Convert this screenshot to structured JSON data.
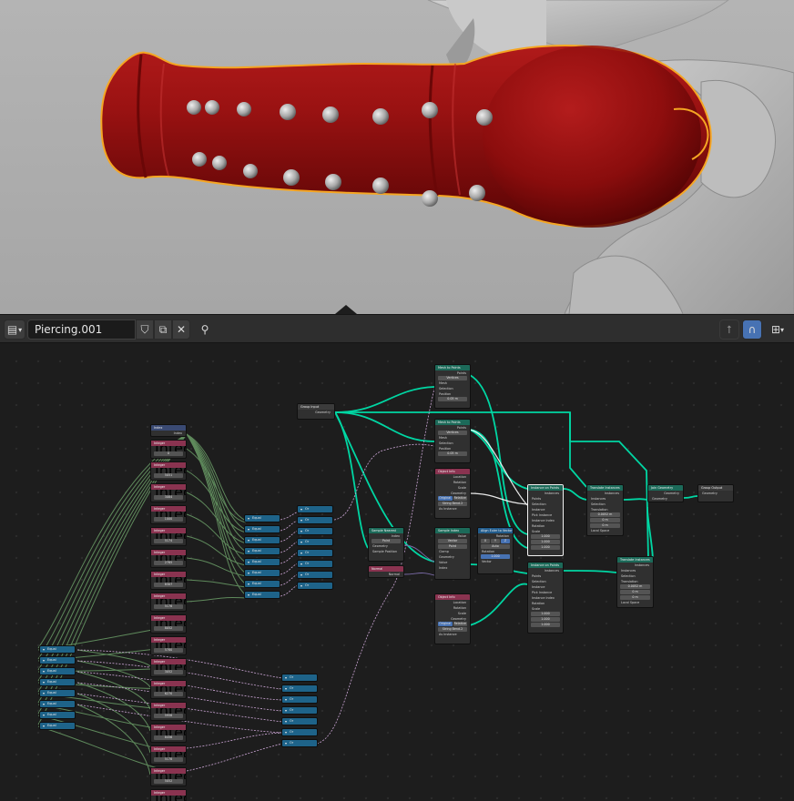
{
  "header": {
    "editor_type_icon": "geometry-node-editor-icon",
    "node_group_name": "Piercing.001"
  },
  "nodes": {
    "index": {
      "title": "Index",
      "out": "Index"
    },
    "integer_title": "Integer",
    "integer_out": "Integer",
    "integer_values": [
      "0",
      "5051",
      "3084",
      "1000",
      "5174",
      "2785",
      "8307",
      "5178",
      "8052",
      "5780",
      "3052",
      "6270",
      "5958",
      "8456",
      "5178",
      "5052",
      "10856",
      "10768"
    ],
    "equal_label": "Equal",
    "or_label": "Or",
    "group_input": {
      "title": "Group Input",
      "out": "Geometry"
    },
    "group_output": {
      "title": "Group Output",
      "in": "Geometry"
    },
    "mesh_to_points_a": {
      "title": "Mesh to Points",
      "out": "Points",
      "mode": "Vertices",
      "rows": [
        "Mesh",
        "Selection",
        "Position",
        "Radius"
      ],
      "radius": "0.05 m"
    },
    "mesh_to_points_b": {
      "title": "Mesh to Points",
      "out": "Points",
      "mode": "Vertices",
      "rows": [
        "Mesh",
        "Selection",
        "Position",
        "Radius"
      ],
      "radius": "0.05 m"
    },
    "object_info_a": {
      "title": "Object Info",
      "rows": [
        "Location",
        "Rotation",
        "Scale",
        "Geometry"
      ],
      "toggle_a": "Original",
      "toggle_b": "Relative",
      "object": "String Bend.2",
      "as_instance": "As Instance"
    },
    "object_info_b": {
      "title": "Object Info",
      "rows": [
        "Location",
        "Rotation",
        "Scale",
        "Geometry"
      ],
      "toggle_a": "Original",
      "toggle_b": "Relative",
      "object": "String Bend.2",
      "as_instance": "As Instance"
    },
    "sample_nearest": {
      "title": "Sample Nearest",
      "out": "Index",
      "mode": "Point",
      "rows": [
        "Geometry",
        "Sample Position"
      ]
    },
    "normal": {
      "title": "Normal",
      "out": "Normal"
    },
    "sample_index": {
      "title": "Sample Index",
      "out": "Value",
      "type": "Vector",
      "domain": "Point",
      "clamp": "Clamp",
      "rows": [
        "Geometry",
        "Value",
        "Index"
      ]
    },
    "align_euler": {
      "title": "Align Euler to Vector",
      "out": "Rotation",
      "axes": [
        "X",
        "Y",
        "Z"
      ],
      "pivot": "Auto",
      "rows": [
        "Rotation",
        "Factor",
        "Vector"
      ],
      "factor": "1.000"
    },
    "instance_a": {
      "title": "Instance on Points",
      "out": "Instances",
      "rows": [
        "Points",
        "Selection",
        "Instance",
        "Pick Instance",
        "Instance Index",
        "Rotation",
        "Scale"
      ],
      "scale": [
        "1.000",
        "1.000",
        "1.000"
      ]
    },
    "instance_b": {
      "title": "Instance on Points",
      "out": "Instances",
      "rows": [
        "Points",
        "Selection",
        "Instance",
        "Pick Instance",
        "Instance Index",
        "Rotation",
        "Scale"
      ],
      "scale": [
        "1.000",
        "1.000",
        "1.000"
      ]
    },
    "translate_a": {
      "title": "Translate Instances",
      "out": "Instances",
      "rows": [
        "Instances",
        "Selection",
        "Translation"
      ],
      "vals": [
        "0.0052 m",
        "0 m",
        "0 m"
      ],
      "local": "Local Space"
    },
    "translate_b": {
      "title": "Translate Instances",
      "out": "Instances",
      "rows": [
        "Instances",
        "Selection",
        "Translation"
      ],
      "vals": [
        "0.0052 m",
        "0 m",
        "0 m"
      ],
      "local": "Local Space"
    },
    "join": {
      "title": "Join Geometry",
      "out": "Geometry",
      "in": "Geometry"
    }
  },
  "colors": {
    "geometry_socket": "#00d6a3",
    "integer_socket": "#598c5c",
    "boolean_socket": "#cca6d6",
    "selection_outline": "#f5a623",
    "object_red": "#8b1010"
  }
}
